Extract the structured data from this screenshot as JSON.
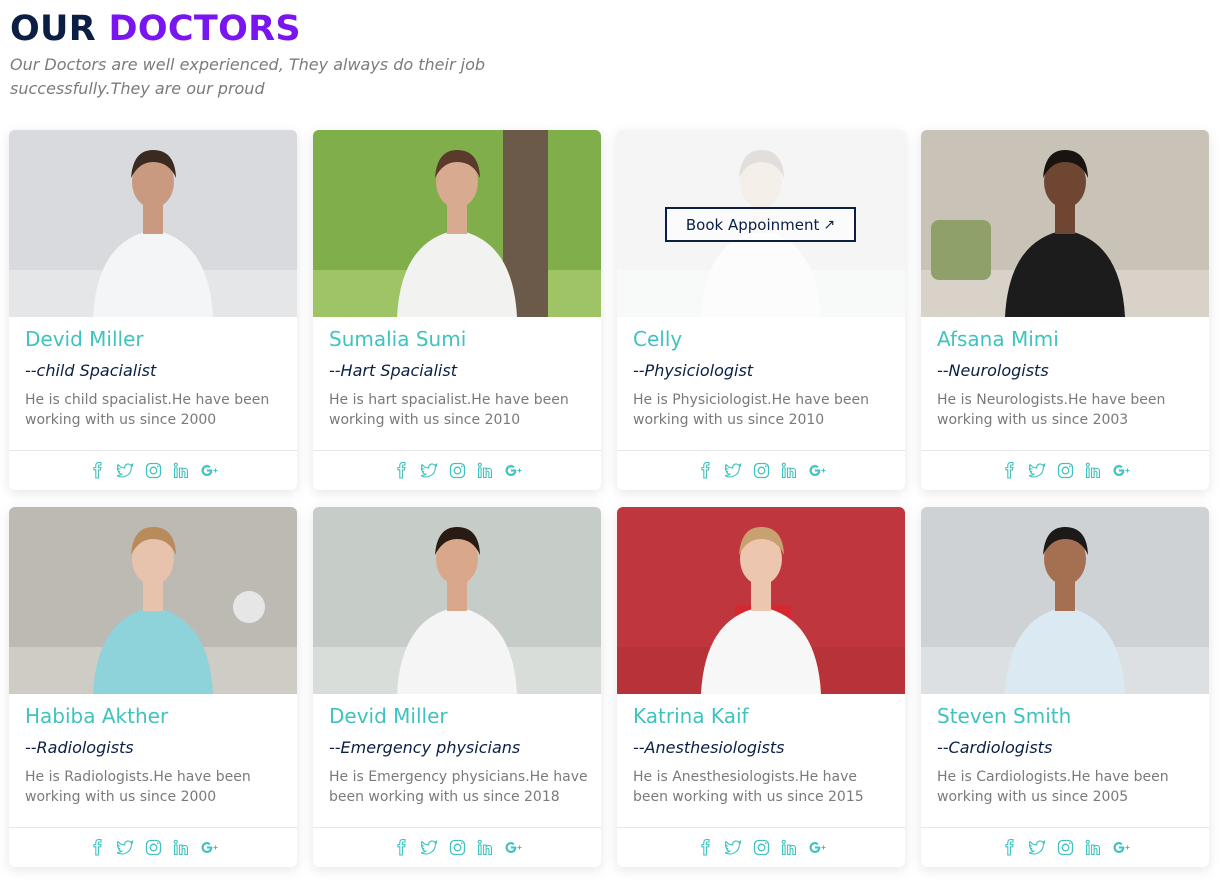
{
  "header": {
    "title_part1": "OUR",
    "title_part2": "DOCTORS",
    "subtitle": "Our Doctors are well experienced, They always do their job successfully.They are our proud"
  },
  "colors": {
    "accent_teal": "#3fc3c0",
    "navy": "#0b1f45",
    "purple": "#7a14f0"
  },
  "hover_card": {
    "book_button": "Book Appoinment"
  },
  "social_icons": [
    "facebook-icon",
    "twitter-icon",
    "instagram-icon",
    "linkedin-icon",
    "google-plus-icon"
  ],
  "doctors": [
    {
      "name": "Devid Miller",
      "specialty": "--child Spacialist",
      "description": "He is child spacialist.He have been working with us since 2000"
    },
    {
      "name": "Sumalia Sumi",
      "specialty": "--Hart Spacialist",
      "description": "He is hart spacialist.He have been working with us since 2010"
    },
    {
      "name": "Celly",
      "specialty": "--Physiciologist",
      "description": "He is Physiciologist.He have been working with us since 2010"
    },
    {
      "name": "Afsana Mimi",
      "specialty": "--Neurologists",
      "description": "He is Neurologists.He have been working with us since 2003"
    },
    {
      "name": "Habiba Akther",
      "specialty": "--Radiologists",
      "description": "He is Radiologists.He have been working with us since 2000"
    },
    {
      "name": "Devid Miller",
      "specialty": "--Emergency physicians",
      "description": "He is Emergency physicians.He have been working with us since 2018"
    },
    {
      "name": "Katrina Kaif",
      "specialty": "--Anesthesiologists",
      "description": "He is Anesthesiologists.He have been working with us since 2015"
    },
    {
      "name": "Steven Smith",
      "specialty": "--Cardiologists",
      "description": "He is Cardiologists.He have been working with us since 2005"
    }
  ]
}
